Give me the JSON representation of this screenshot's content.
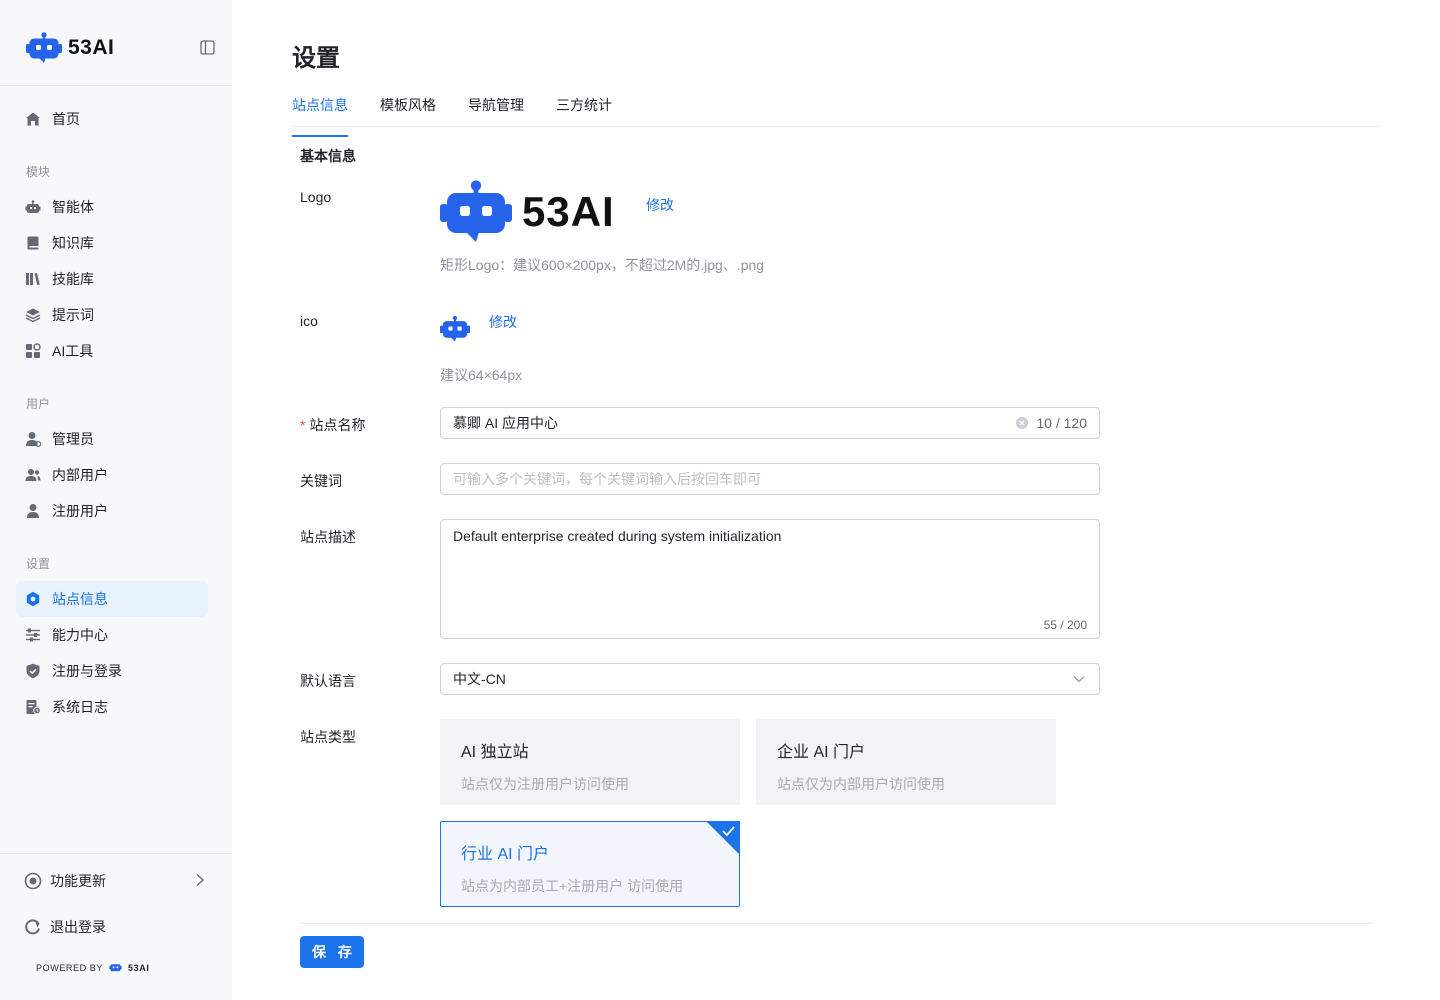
{
  "brand": {
    "name": "53AI"
  },
  "sidebar": {
    "home": "首页",
    "sections": {
      "modules": "模块",
      "users": "用户",
      "settings": "设置"
    },
    "module_items": [
      "智能体",
      "知识库",
      "技能库",
      "提示词",
      "AI工具"
    ],
    "user_items": [
      "管理员",
      "内部用户",
      "注册用户"
    ],
    "setting_items": [
      "站点信息",
      "能力中心",
      "注册与登录",
      "系统日志"
    ],
    "active_item": "站点信息",
    "updates": "功能更新",
    "logout": "退出登录",
    "powered_by": "POWERED BY",
    "powered_brand": "53AI"
  },
  "page": {
    "title": "设置",
    "tabs": [
      "站点信息",
      "模板风格",
      "导航管理",
      "三方统计"
    ],
    "active_tab": "站点信息"
  },
  "form": {
    "section_title": "基本信息",
    "logo": {
      "label": "Logo",
      "edit": "修改",
      "hint": "矩形Logo：建议600×200px，不超过2M的.jpg、.png"
    },
    "ico": {
      "label": "ico",
      "edit": "修改",
      "hint": "建议64×64px"
    },
    "site_name": {
      "label": "站点名称",
      "required": "*",
      "value": "慕卿 AI 应用中心",
      "counter": "10 / 120"
    },
    "keywords": {
      "label": "关键词",
      "placeholder": "可输入多个关键词，每个关键词输入后按回车即可"
    },
    "description": {
      "label": "站点描述",
      "value": "Default enterprise created during system initialization",
      "counter": "55 / 200"
    },
    "language": {
      "label": "默认语言",
      "value": "中文-CN"
    },
    "site_type": {
      "label": "站点类型",
      "options": [
        {
          "title": "AI 独立站",
          "desc": "站点仅为注册用户访问使用",
          "selected": false
        },
        {
          "title": "企业 AI 门户",
          "desc": "站点仅为内部用户访问使用",
          "selected": false
        },
        {
          "title": "行业 AI 门户",
          "desc": "站点为内部员工+注册用户 访问使用",
          "selected": true
        }
      ]
    },
    "save": "保 存"
  },
  "colors": {
    "accent": "#1a73e8",
    "robot": "#2563eb",
    "required": "#f54a45",
    "sidebar_bg": "#f7f8fa",
    "active_bg": "#e8f1fe"
  }
}
